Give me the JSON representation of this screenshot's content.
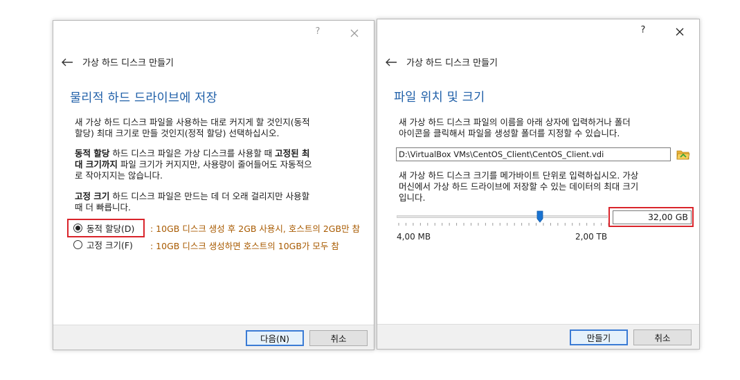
{
  "dialog1": {
    "title": "가상 하드 디스크 만들기",
    "help_label": "?",
    "heading": "물리적 하드 드라이브에 저장",
    "para1": [
      "새 가상 하드 디스크 파일을 사용하는 대로 커지게 할 것인지(동적",
      "할당) 최대 크기로 만들 것인지(정적 할당) 선택하십시오."
    ],
    "para2": {
      "line1_bold_a": "동적 할당",
      "line1_text": " 하드 디스크 파일은 가상 디스크를 사용할 때 ",
      "line1_bold_b": "고정된 최",
      "line2_bold": "대 크기까지",
      "line2_text": " 파일 크기가 커지지만, 사용량이 줄어들어도 자동적으",
      "line3": "로 작아지지는 않습니다."
    },
    "para3": {
      "line1_bold": "고정 크기",
      "line1_text": " 하드 디스크 파일은 만드는 데 더 오래 걸리지만 사용할",
      "line2": "때 더 빠릅니다."
    },
    "radio_dynamic": {
      "label": "동적 할당(D)",
      "checked": true
    },
    "radio_fixed": {
      "label": "고정 크기(F)",
      "checked": false
    },
    "next_button": "다음(N)",
    "cancel_button": "취소"
  },
  "annotations": {
    "dynamic_note": ": 10GB 디스크 생성 후 2GB 사용시, 호스트의 2GB만 참",
    "fixed_note": ": 10GB 디스크 생성하면 호스트의 10GB가 모두 참"
  },
  "dialog2": {
    "title": "가상 하드 디스크 만들기",
    "help_label": "?",
    "heading": "파일 위치 및 크기",
    "para1": [
      "새 가상 하드 디스크 파일의 이름을 아래 상자에 입력하거나 폴더",
      "아이콘을 클릭해서 파일을 생성할 폴더를 지정할 수 있습니다."
    ],
    "file_path": "D:\\VirtualBox VMs\\CentOS_Client\\CentOS_Client.vdi",
    "para2": [
      "새 가상 하드 디스크 크기를 메가바이트 단위로 입력하십시오. 가상",
      "머신에서 가상 하드 드라이브에 저장할 수 있는 데이터의 최대 크기",
      "입니다."
    ],
    "slider": {
      "min_label": "4,00 MB",
      "max_label": "2,00 TB",
      "position_fraction": 0.68
    },
    "size_value": "32,00 GB",
    "create_button": "만들기",
    "cancel_button": "취소"
  },
  "colors": {
    "heading": "#1f5fa8",
    "annotation": "#a85a00",
    "highlight_box": "#d9232a",
    "slider_thumb": "#1a73d1"
  }
}
